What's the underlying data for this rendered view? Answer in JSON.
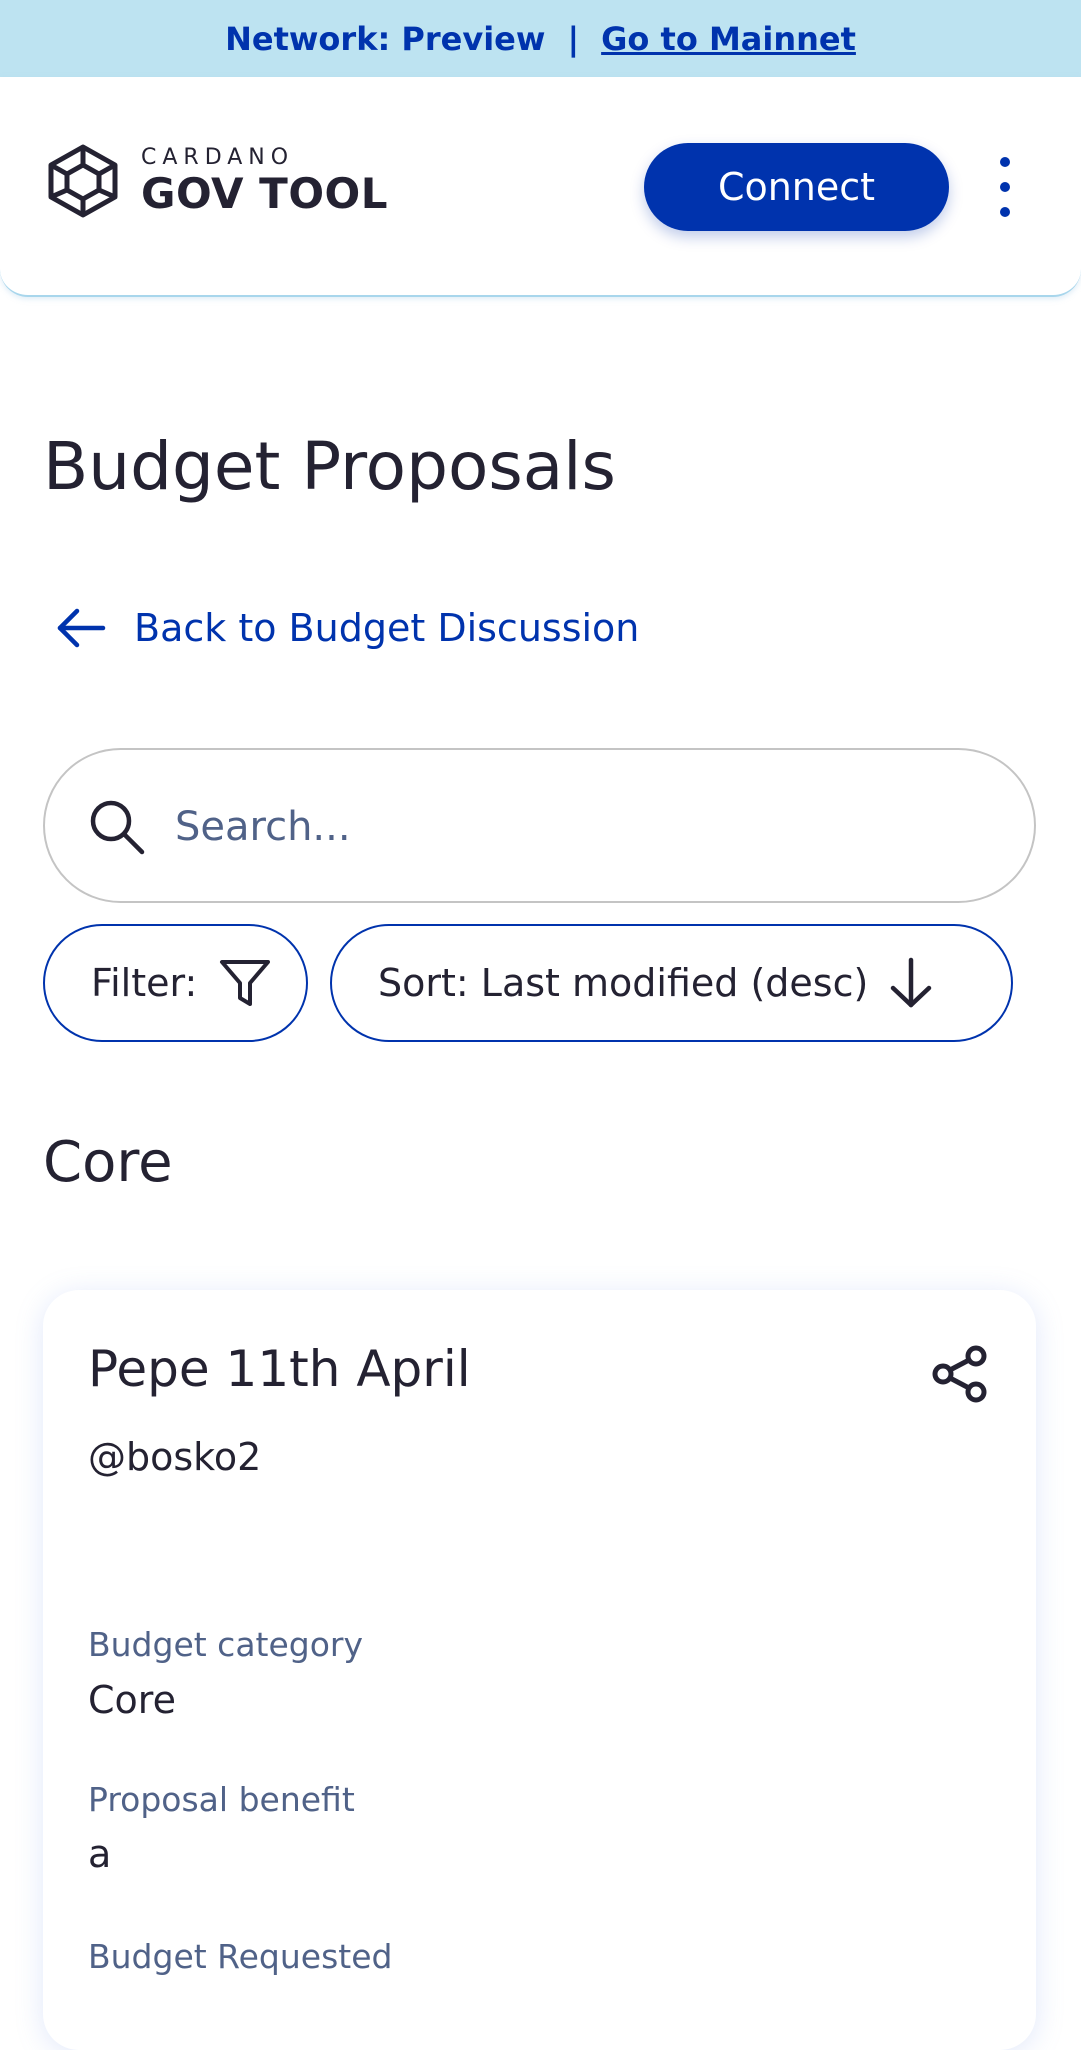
{
  "banner": {
    "network_label": "Network: Preview",
    "separator": "|",
    "mainnet_link": "Go to Mainnet"
  },
  "header": {
    "brand_small": "CARDANO",
    "brand_big": "GOV TOOL",
    "connect_label": "Connect"
  },
  "page": {
    "title": "Budget Proposals",
    "back_label": "Back to Budget Discussion"
  },
  "search": {
    "placeholder": "Search...",
    "value": ""
  },
  "controls": {
    "filter_label": "Filter:",
    "sort_label": "Sort: Last modified (desc)"
  },
  "section": {
    "title": "Core"
  },
  "proposal": {
    "title": "Pepe 11th April",
    "author": "@bosko2",
    "fields": [
      {
        "label": "Budget category",
        "value": "Core"
      },
      {
        "label": "Proposal benefit",
        "value": "a"
      },
      {
        "label": "Budget Requested",
        "value": ""
      }
    ]
  },
  "colors": {
    "brand_blue": "#0033ad",
    "banner_bg": "#bde3f1",
    "label_gray": "#506288",
    "text_dark": "#242232"
  },
  "icons": [
    "cardano-logo-icon",
    "kebab-menu-icon",
    "arrow-left-icon",
    "search-icon",
    "filter-funnel-icon",
    "arrow-down-icon",
    "share-icon"
  ]
}
